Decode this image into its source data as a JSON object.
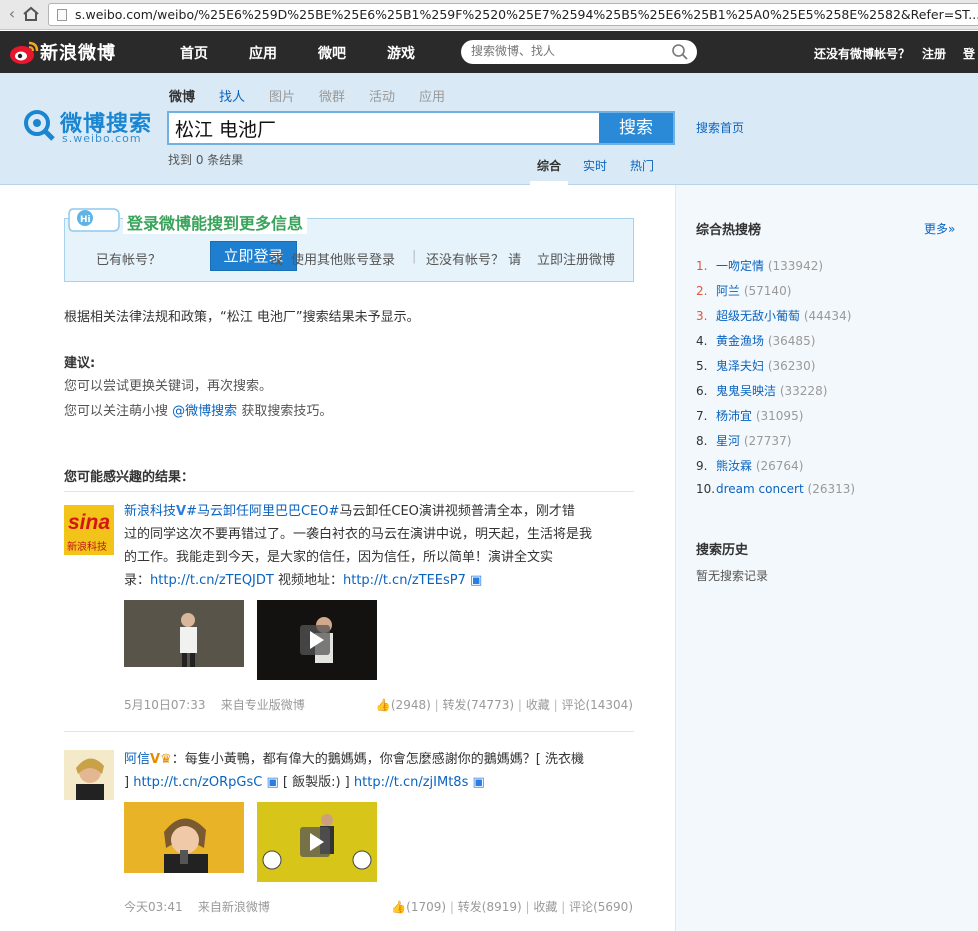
{
  "browser": {
    "url": "s.weibo.com/weibo/%25E6%259D%25BE%25E6%25B1%259F%2520%25E7%2594%25B5%25E6%25B1%25A0%25E5%258E%2582&Refer=ST..."
  },
  "topnav": {
    "logo_text": "新浪微博",
    "links": [
      "首页",
      "应用",
      "微吧",
      "游戏"
    ],
    "search_placeholder": "搜索微博、找人",
    "no_account": "还没有微博帐号？",
    "register": "注册",
    "login": "登"
  },
  "header": {
    "brand_cn": "微博搜索",
    "brand_en": "s.weibo.com",
    "tabs": [
      "微博",
      "找人",
      "图片",
      "微群",
      "活动",
      "应用"
    ],
    "query": "松江 电池厂",
    "search_button": "搜索",
    "search_home": "搜索首页",
    "found": "找到 0 条结果",
    "sort_tabs": [
      "综合",
      "实时",
      "热门"
    ]
  },
  "login_box": {
    "title": "登录微博能搜到更多信息",
    "have_account": "已有帐号？",
    "login_now": "立即登录",
    "or": "或",
    "other_login": "使用其他账号登录",
    "no_account": "还没有帐号？ 请",
    "register_now": "立即注册微博"
  },
  "notice": "根据相关法律法规和政策，“松江 电池厂”搜索结果未予显示。",
  "suggestion": {
    "title": "建议:",
    "line1": "您可以尝试更换关键词，再次搜索。",
    "line2_prefix": "您可以关注萌小搜",
    "line2_link": "@微博搜索",
    "line2_suffix": "获取搜索技巧。"
  },
  "interest_title": "您可能感兴趣的结果：",
  "feeds": [
    {
      "user": "新浪科技",
      "avatar_text": "sina",
      "avatar_sub": "新浪科技",
      "line1_tag": "#马云卸任阿里巴巴CEO#",
      "line1": "马云卸任CEO演讲视频普清全本，刚才错",
      "line2": "过的同学这次不要再错过了。一袭白衬衣的马云在演讲中说，明天起，生活将是我",
      "line3": "的工作。我能走到今天，是大家的信任，因为信任，所以简单！演讲全文实",
      "line4_prefix": "录：",
      "link1": "http://t.cn/zTEQJDT",
      "line4_mid": "视频地址：",
      "link2": "http://t.cn/zTEEsP7",
      "time": "5月10日07:33",
      "source": "来自专业版微博",
      "likes": "(2948)",
      "forward": "转发(74773)",
      "fav": "收藏",
      "comment": "评论(14304)"
    },
    {
      "user": "阿信",
      "line1": "：每隻小黃鴨，都有偉大的鵝媽媽，你會怎麼感謝你的鵝媽媽？[ 洗衣機",
      "line2_prefix": "]",
      "link1": "http://t.cn/zORpGsC",
      "line2_mid": "[ 飯製版:) ]",
      "link2": "http://t.cn/zjIMt8s",
      "time": "今天03:41",
      "source": "来自新浪微博",
      "likes": "(1709)",
      "forward": "转发(8919)",
      "fav": "收藏",
      "comment": "评论(5690)"
    }
  ],
  "hot": {
    "title": "综合热搜榜",
    "more": "更多»",
    "items": [
      {
        "rank": "1.",
        "name": "一吻定情",
        "count": "(133942)"
      },
      {
        "rank": "2.",
        "name": "阿兰",
        "count": "(57140)"
      },
      {
        "rank": "3.",
        "name": "超级无敌小葡萄",
        "count": "(44434)"
      },
      {
        "rank": "4.",
        "name": "黄金渔场",
        "count": "(36485)"
      },
      {
        "rank": "5.",
        "name": "鬼泽夫妇",
        "count": "(36230)"
      },
      {
        "rank": "6.",
        "name": "鬼鬼吴映洁",
        "count": "(33228)"
      },
      {
        "rank": "7.",
        "name": "杨沛宜",
        "count": "(31095)"
      },
      {
        "rank": "8.",
        "name": "星河",
        "count": "(27737)"
      },
      {
        "rank": "9.",
        "name": "熊汝霖",
        "count": "(26764)"
      },
      {
        "rank": "10.",
        "name": "dream concert",
        "count": "(26313)"
      }
    ]
  },
  "history": {
    "title": "搜索历史",
    "empty": "暂无搜索记录"
  },
  "colors": {
    "accent": "#0a63bf",
    "nav_bg": "#2a2a2a",
    "header_bg": "#d9eaf6",
    "rank_top": "#e2543a"
  }
}
